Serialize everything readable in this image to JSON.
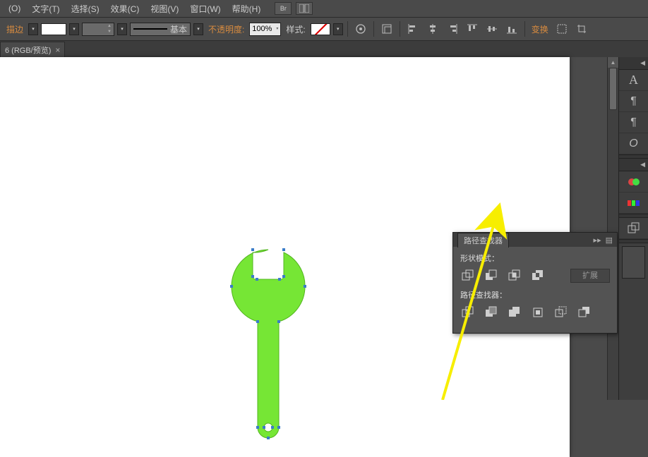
{
  "menu": {
    "object": "(O)",
    "type": "文字(T)",
    "select": "选择(S)",
    "effect": "效果(C)",
    "view": "视图(V)",
    "window": "窗口(W)",
    "help": "帮助(H)",
    "br_label": "Br"
  },
  "optionbar": {
    "stroke_label": "描边",
    "stroke_width": "",
    "stroke_style_label": "基本",
    "opacity_label": "不透明度:",
    "opacity_value": "100%",
    "style_label": "样式:",
    "transform_label": "变换"
  },
  "doc_tab": {
    "label": "6 (RGB/预览)"
  },
  "panel": {
    "title": "路径查找器",
    "shape_mode": "形状模式：",
    "expand": "扩展",
    "pathfinder_label": "路径查找器："
  },
  "shape": {
    "fill": "#76e635",
    "stroke": "#52b51f"
  },
  "chart_data": null
}
